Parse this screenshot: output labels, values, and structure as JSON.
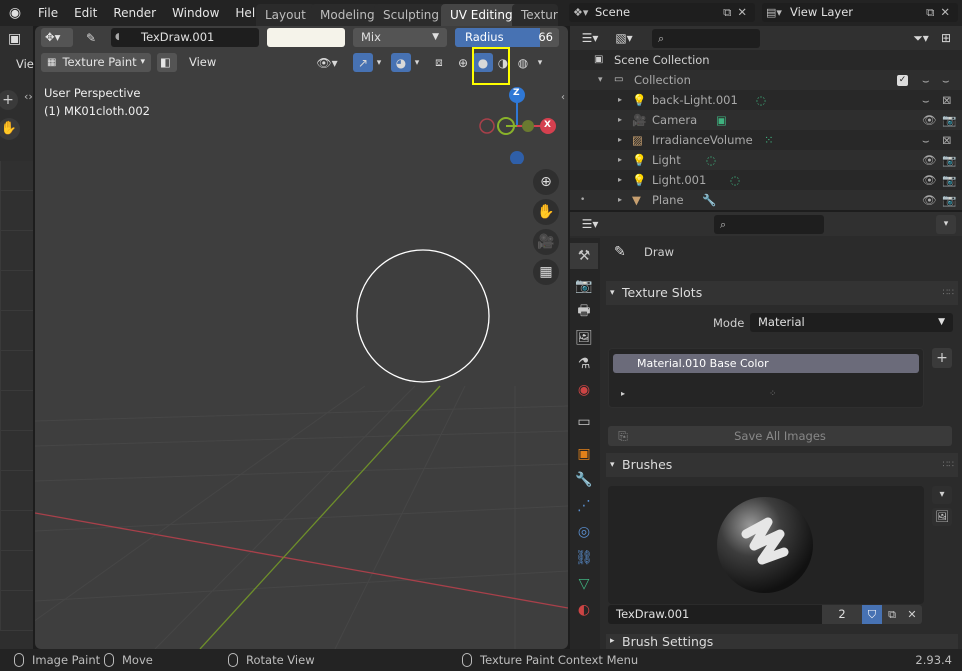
{
  "menus": [
    "File",
    "Edit",
    "Render",
    "Window",
    "Help"
  ],
  "workspace_tabs": [
    {
      "label": "Layout",
      "active": false
    },
    {
      "label": "Modeling",
      "active": false
    },
    {
      "label": "Sculpting",
      "active": false
    },
    {
      "label": "UV Editing",
      "active": true
    },
    {
      "label": "Texture",
      "active": false
    }
  ],
  "scene": {
    "name": "Scene",
    "view_layer": "View Layer"
  },
  "toolbar": {
    "brush_name": "TexDraw.001",
    "color_hex": "#f5f3ea",
    "blend_mode": "Mix",
    "radius_label": "Radius",
    "radius_value": "66",
    "radius_fill": 0.82
  },
  "left_strip": {
    "label": "Vie"
  },
  "viewport": {
    "mode": "Texture Paint",
    "view_menu": "View",
    "perspective": "User Perspective",
    "object_info": "(1) MK01cloth.002"
  },
  "gizmo": {
    "z": "Z",
    "x": "X"
  },
  "outliner": {
    "root": "Scene Collection",
    "collection": "Collection",
    "items": [
      {
        "name": "back-Light.001"
      },
      {
        "name": "Camera"
      },
      {
        "name": "IrradianceVolume"
      },
      {
        "name": "Light"
      },
      {
        "name": "Light.001"
      },
      {
        "name": "Plane"
      }
    ]
  },
  "properties": {
    "tool_name": "Draw",
    "texture_slots_title": "Texture Slots",
    "mode_label": "Mode",
    "mode_value": "Material",
    "slot_item": "Material.010 Base Color",
    "save_all_images": "Save All Images",
    "brushes_title": "Brushes",
    "brush_name": "TexDraw.001",
    "brush_users": "2",
    "brush_settings_title": "Brush Settings"
  },
  "status_bar": {
    "left_click": "Image Paint",
    "middle_click": "Move",
    "rotate": "Rotate View",
    "context_menu": "Texture Paint Context Menu",
    "version": "2.93.4"
  },
  "colors": {
    "highlight": "#ffff00",
    "accent_blue": "#4772b3",
    "axis_x": "#d5404f",
    "axis_y": "#89b22a",
    "axis_z": "#2f78d6"
  }
}
